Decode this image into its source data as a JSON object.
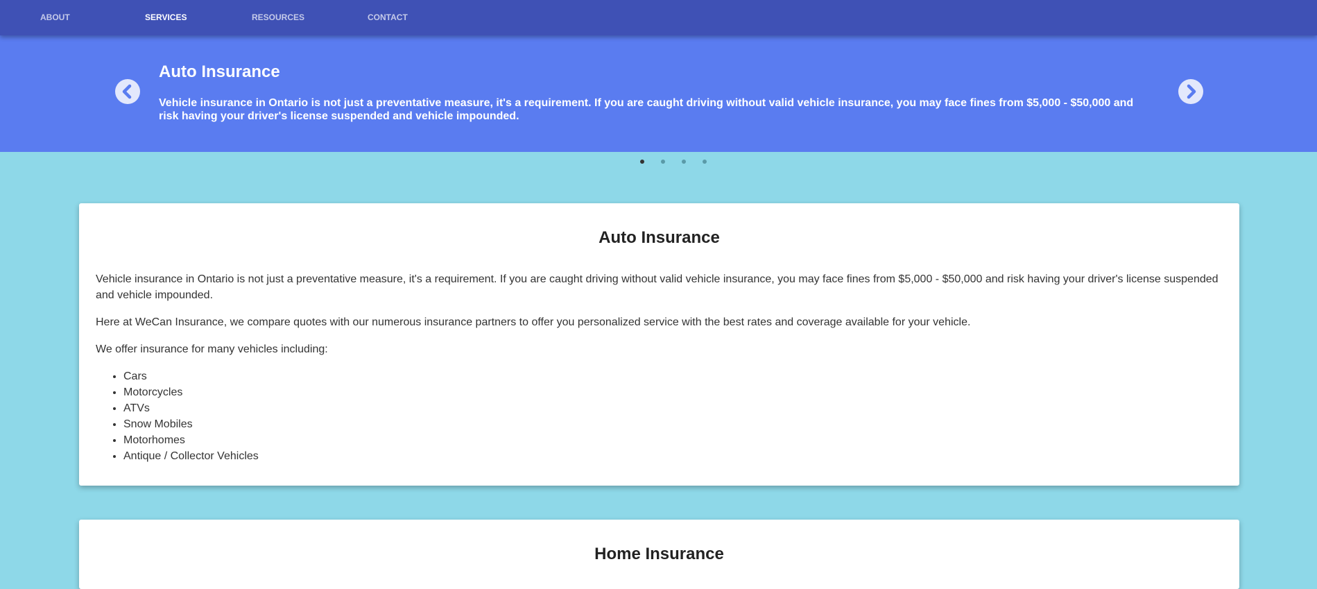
{
  "nav": {
    "items": [
      {
        "label": "ABOUT"
      },
      {
        "label": "SERVICES"
      },
      {
        "label": "RESOURCES"
      },
      {
        "label": "CONTACT"
      }
    ]
  },
  "carousel": {
    "slide_title": "Auto Insurance",
    "slide_text": "Vehicle insurance in Ontario is not just a preventative measure, it's a requirement. If you are caught driving without valid vehicle insurance, you may face fines from $5,000 - $50,000 and risk having your driver's license suspended and vehicle impounded.",
    "active_slide": 1,
    "slide_count": 4
  },
  "card": {
    "title": "Auto Insurance",
    "paragraphs": [
      "Vehicle insurance in Ontario is not just a preventative measure, it's a requirement. If you are caught driving without valid vehicle insurance, you may face fines from $5,000 - $50,000 and risk having your driver's license suspended and vehicle impounded.",
      "Here at WeCan Insurance, we compare quotes with our numerous insurance partners to offer you personalized service with the best rates and coverage available for your vehicle.",
      "We offer insurance for many vehicles including:"
    ],
    "vehicles": [
      "Cars",
      "Motorcycles",
      "ATVs",
      "Snow Mobiles",
      "Motorhomes",
      "Antique / Collector Vehicles"
    ]
  },
  "next_card": {
    "title": "Home Insurance"
  },
  "colors": {
    "navbar": "#3f51b5",
    "carousel": "#5a7cf0",
    "page_background": "#8ed8e8",
    "card": "#ffffff"
  }
}
